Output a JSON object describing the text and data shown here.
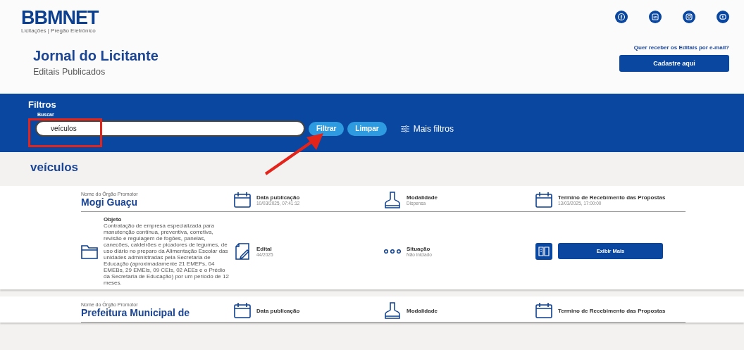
{
  "header": {
    "logo": "BBMNET",
    "tagline": "Licitações | Pregão Eletrônico",
    "title": "Jornal do Licitante",
    "subtitle": "Editais Publicados",
    "email_prompt": "Quer receber os Editais por e-mail?",
    "signup_button": "Cadastre aqui",
    "social": [
      {
        "kind": "facebook"
      },
      {
        "kind": "linkedin"
      },
      {
        "kind": "instagram"
      },
      {
        "kind": "youtube"
      }
    ]
  },
  "filters": {
    "title": "Filtros",
    "search_label": "Buscar",
    "search_value": "veículos",
    "buttons": [
      "Filtrar",
      "Limpar"
    ],
    "more_filters": "Mais filtros"
  },
  "results_heading": "veículos",
  "cards": [
    {
      "promoter_label": "Nome do Órgão Promotor",
      "promoter": "Mogi Guaçu",
      "fields": [
        {
          "kind": "calendar",
          "label": "Data publicação",
          "value": "10/03/2025, 07:41:12"
        },
        {
          "kind": "stamp",
          "label": "Modalidade",
          "value": "Dispensa"
        },
        {
          "kind": "calendar",
          "label": "Termino de Recebimento das Propostas",
          "value": "13/03/2025, 17:00:00"
        }
      ],
      "object": {
        "label": "Objeto",
        "text": "Contratação de empresa especializada para manutenção contínua, preventiva, corretiva, revisão e regulagem de fogões, panelas, canecões, caldeirões e picadores de legumes, de uso diário no preparo da Alimentação Escolar das unidades administradas pela Secretaria de Educação (aproximadamente 21 EMEFs, 04 EMEBs, 29 EMEIs, 09 CEIs, 02 AEEs e o Prédio da Secretaria de Educação) por um período de 12 meses."
      },
      "details": [
        {
          "kind": "document",
          "label": "Edital",
          "value": "44/2025"
        },
        {
          "kind": "dots",
          "label": "Situação",
          "value": "Não iniciado"
        }
      ],
      "action": "Exibir Mais"
    },
    {
      "promoter_label": "Nome do Órgão Promotor",
      "promoter": "Prefeitura Municipal de",
      "fields": [
        {
          "kind": "calendar",
          "label": "Data publicação"
        },
        {
          "kind": "stamp",
          "label": "Modalidade"
        },
        {
          "kind": "calendar",
          "label": "Termino de Recebimento das Propostas"
        }
      ]
    }
  ]
}
